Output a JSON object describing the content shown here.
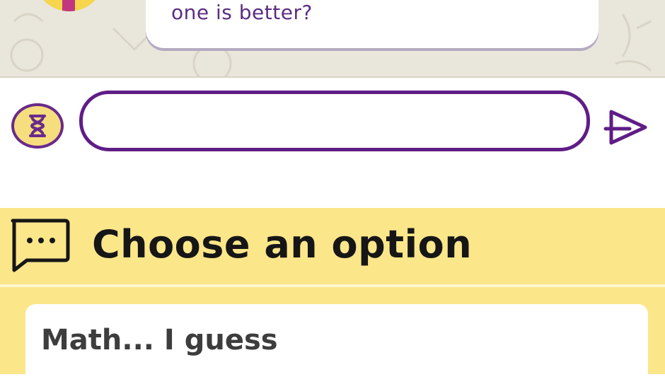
{
  "chat": {
    "message_text": "one is better?"
  },
  "input": {
    "value": "",
    "placeholder": ""
  },
  "icons": {
    "timer": "hourglass-icon",
    "send": "send-arrow-icon",
    "options": "chat-bubble-dots-icon"
  },
  "options_panel": {
    "title": "Choose an option",
    "items": [
      {
        "label": "Math... I guess"
      }
    ]
  },
  "colors": {
    "accent_purple": "#5f1d86",
    "panel_yellow": "#fbe68a",
    "chat_background": "#e9e6dc"
  }
}
